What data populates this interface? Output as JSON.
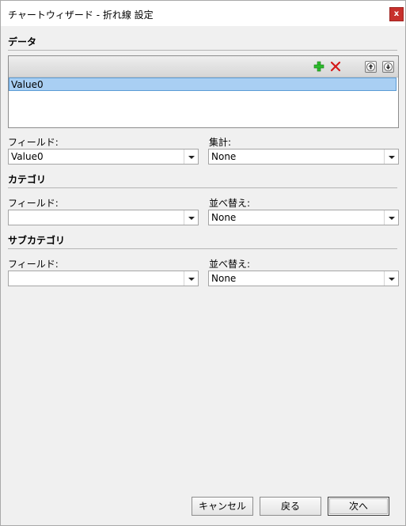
{
  "window": {
    "title": "チャートウィザード - 折れ線 設定",
    "close_label": "x"
  },
  "data_section": {
    "title": "データ",
    "toolbar_icons": [
      "add-icon",
      "delete-icon",
      "move-up-icon",
      "move-down-icon"
    ],
    "items": [
      "Value0"
    ],
    "field_label": "フィールド:",
    "field_value": "Value0",
    "aggregate_label": "集計:",
    "aggregate_value": "None"
  },
  "category_section": {
    "title": "カテゴリ",
    "field_label": "フィールド:",
    "field_value": "",
    "sort_label": "並べ替え:",
    "sort_value": "None"
  },
  "subcategory_section": {
    "title": "サブカテゴリ",
    "field_label": "フィールド:",
    "field_value": "",
    "sort_label": "並べ替え:",
    "sort_value": "None"
  },
  "buttons": {
    "cancel": "キャンセル",
    "back": "戻る",
    "next": "次へ"
  },
  "colors": {
    "close_button": "#c7302c",
    "add_icon": "#2dbb2d",
    "delete_icon": "#d51a1a",
    "selected_row": "#a9cff3"
  }
}
